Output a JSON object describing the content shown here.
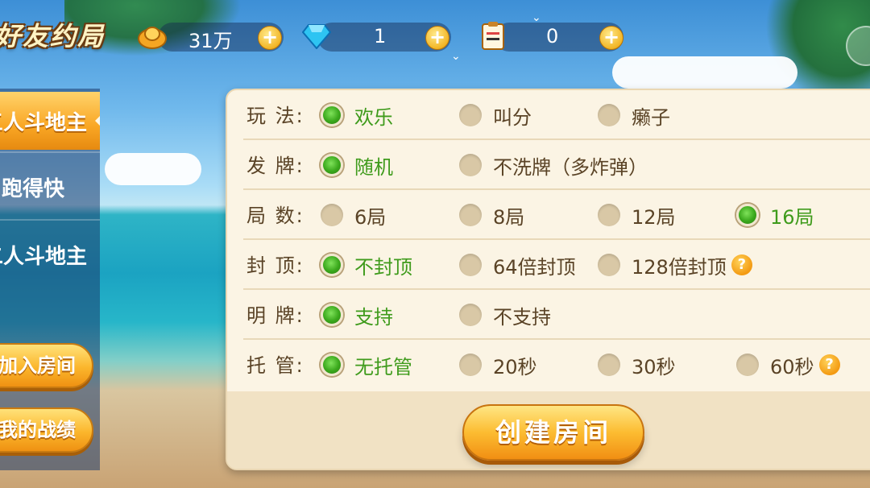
{
  "header": {
    "title": "好友约局",
    "gold": {
      "icon": "gold-ingot-icon",
      "value": "31万"
    },
    "diamond": {
      "icon": "diamond-icon",
      "value": "1"
    },
    "card": {
      "icon": "room-card-icon",
      "value": "0"
    },
    "plus_symbol": "+"
  },
  "sidebar": {
    "tabs": [
      {
        "label": "三人斗地主",
        "active": true
      },
      {
        "label": "跑得快",
        "active": false
      },
      {
        "label": "二人斗地主",
        "active": false
      }
    ],
    "join_room": "加入房间",
    "my_record": "我的战绩"
  },
  "options": {
    "rules": {
      "label": "玩  法:",
      "items": [
        {
          "text": "欢乐",
          "selected": true
        },
        {
          "text": "叫分",
          "selected": false
        },
        {
          "text": "癞子",
          "selected": false
        }
      ]
    },
    "deal": {
      "label": "发  牌:",
      "items": [
        {
          "text": "随机",
          "selected": true
        },
        {
          "text": "不洗牌（多炸弹）",
          "selected": false
        }
      ]
    },
    "rounds": {
      "label": "局  数:",
      "items": [
        {
          "text": "6局",
          "selected": false
        },
        {
          "text": "8局",
          "selected": false
        },
        {
          "text": "12局",
          "selected": false
        },
        {
          "text": "16局",
          "selected": true
        }
      ]
    },
    "cap": {
      "label": "封  顶:",
      "items": [
        {
          "text": "不封顶",
          "selected": true
        },
        {
          "text": "64倍封顶",
          "selected": false
        },
        {
          "text": "128倍封顶",
          "selected": false
        }
      ]
    },
    "open_card": {
      "label": "明  牌:",
      "items": [
        {
          "text": "支持",
          "selected": true
        },
        {
          "text": "不支持",
          "selected": false
        }
      ]
    },
    "auto_play": {
      "label": "托  管:",
      "items": [
        {
          "text": "无托管",
          "selected": true
        },
        {
          "text": "20秒",
          "selected": false
        },
        {
          "text": "30秒",
          "selected": false
        },
        {
          "text": "60秒",
          "selected": false
        }
      ]
    },
    "help_symbol": "?"
  },
  "create_button": "创建房间",
  "colors": {
    "selected_text": "#3f9b1c",
    "accent": "#f9a624",
    "panel_bg": "#fbf4e4"
  }
}
